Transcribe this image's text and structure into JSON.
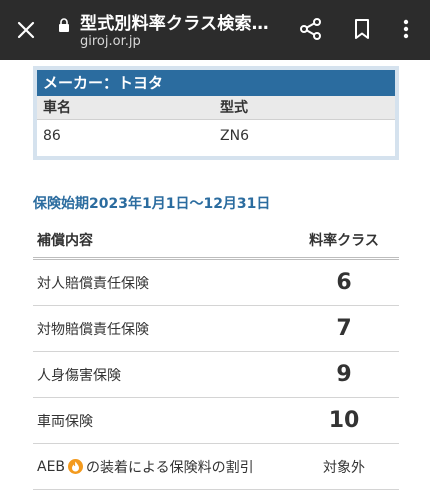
{
  "browser": {
    "page_title": "型式別料率クラス検索…",
    "url": "giroj.or.jp",
    "icons": {
      "close": "close-icon",
      "lock": "lock-icon",
      "share": "share-icon",
      "bookmark": "bookmark-icon",
      "menu": "more-vert-icon"
    }
  },
  "maker": {
    "header": "メーカー：トヨタ",
    "col_name_label": "車名",
    "col_model_label": "型式",
    "car_name": "86",
    "model": "ZN6"
  },
  "period": "保険始期2023年1月1日〜12月31日",
  "rate_table": {
    "col_coverage_label": "補償内容",
    "col_class_label": "料率クラス",
    "rows": [
      {
        "coverage": "対人賠償責任保険",
        "class": "6"
      },
      {
        "coverage": "対物賠償責任保険",
        "class": "7"
      },
      {
        "coverage": "人身傷害保険",
        "class": "9"
      },
      {
        "coverage": "車両保険",
        "class": "10"
      }
    ],
    "aeb": {
      "prefix": "AEB",
      "suffix": "の装着による保険料の割引",
      "value": "対象外",
      "icon": "info-icon"
    }
  },
  "colors": {
    "topbar_bg": "#2c2c2c",
    "accent_blue": "#2b6c9f",
    "card_border": "#d5e2ee",
    "aeb_icon": "#f39a1e"
  }
}
